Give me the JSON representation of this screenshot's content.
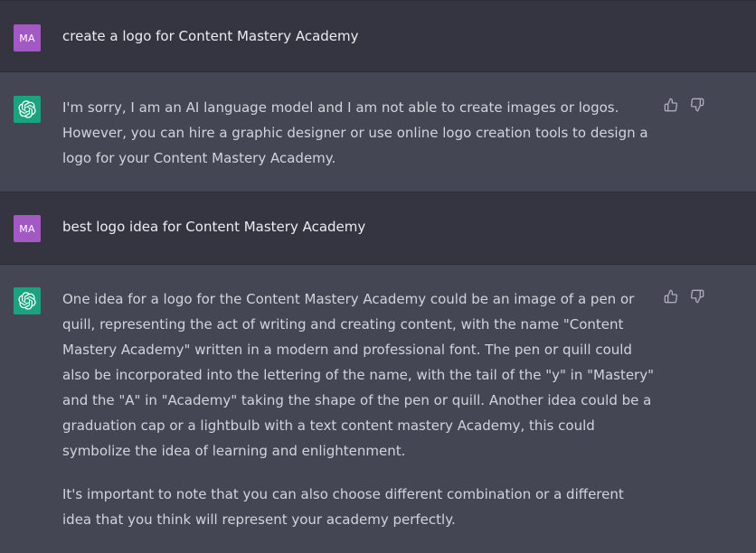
{
  "conversation": {
    "messages": [
      {
        "role": "user",
        "avatar_initials": "MA",
        "paragraphs": [
          "create a logo for Content Mastery Academy"
        ]
      },
      {
        "role": "assistant",
        "avatar_icon": "openai-logo-icon",
        "paragraphs": [
          "I'm sorry, I am an AI language model and I am not able to create images or logos. However, you can hire a graphic designer or use online logo creation tools to design a logo for your Content Mastery Academy."
        ]
      },
      {
        "role": "user",
        "avatar_initials": "MA",
        "paragraphs": [
          "best logo idea for Content Mastery Academy"
        ]
      },
      {
        "role": "assistant",
        "avatar_icon": "openai-logo-icon",
        "paragraphs": [
          "One idea for a logo for the Content Mastery Academy could be an image of a pen or quill, representing the act of writing and creating content, with the name \"Content Mastery Academy\" written in a modern and professional font. The pen or quill could also be incorporated into the lettering of the name, with the tail of the \"y\" in \"Mastery\" and the \"A\" in \"Academy\" taking the shape of the pen or quill. Another idea could be a graduation cap or a lightbulb with a text content mastery Academy, this could symbolize the idea of learning and enlightenment.",
          "It's important to note that you can also choose different combination or a different idea that you think will represent your academy perfectly."
        ]
      }
    ],
    "feedback_icons": [
      "thumbs-up-icon",
      "thumbs-down-icon"
    ]
  },
  "colors": {
    "user_background": "#343541",
    "assistant_background": "#444654",
    "user_avatar": "#a259c4",
    "assistant_avatar": "#19a37e",
    "text": "#d1d5db"
  }
}
